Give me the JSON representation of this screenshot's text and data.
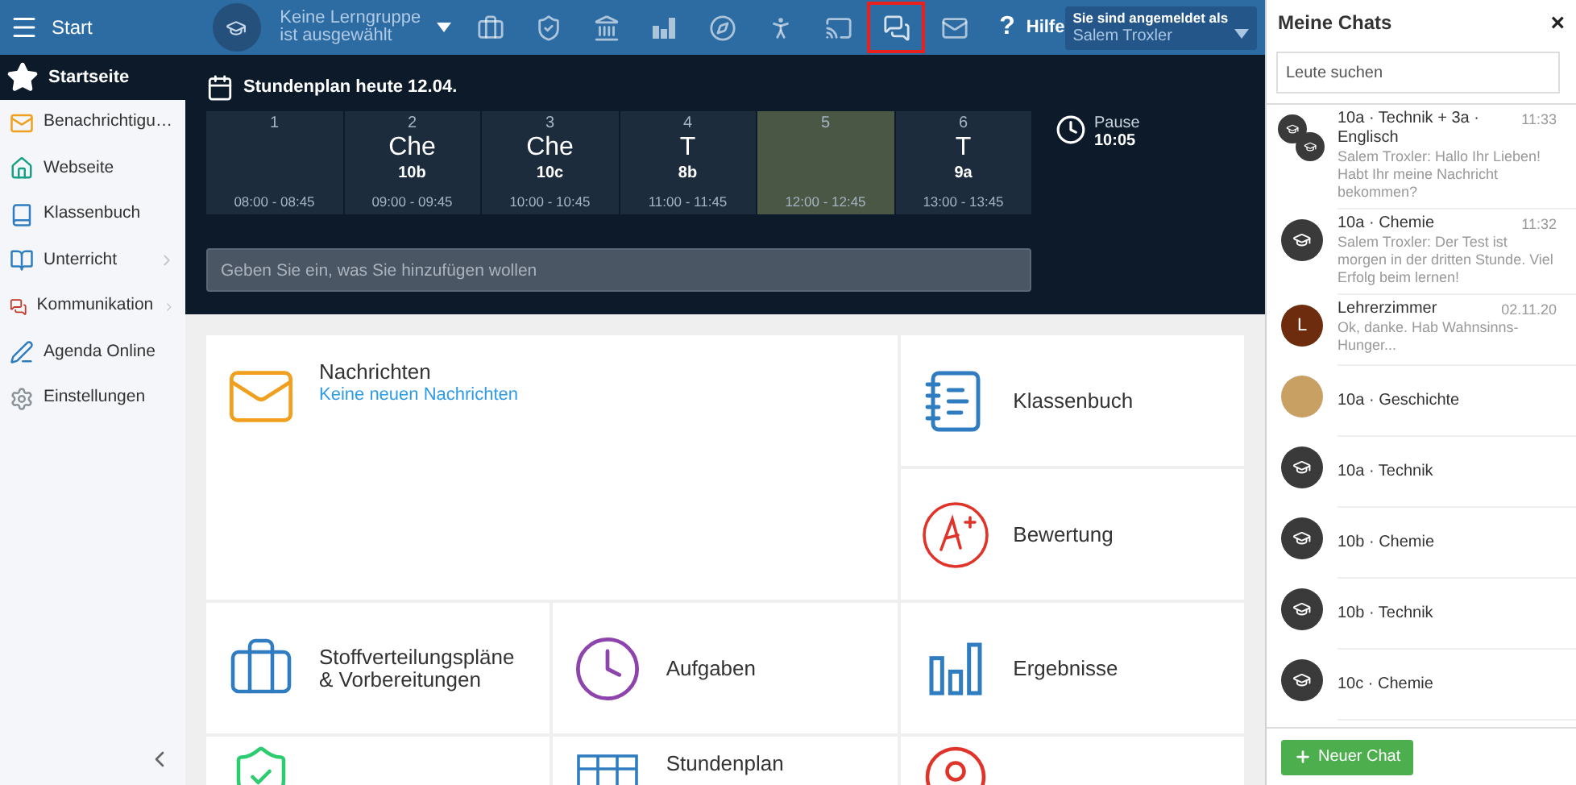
{
  "topbar": {
    "title": "Start",
    "group": {
      "line1": "Keine Lerngruppe",
      "line2": "ist ausgewählt"
    },
    "tools": [
      {
        "selected": false
      },
      {
        "selected": false
      },
      {
        "selected": false
      },
      {
        "selected": false
      },
      {
        "selected": false
      },
      {
        "selected": false
      },
      {
        "selected": false
      },
      {
        "selected": true
      },
      {
        "selected": false
      }
    ],
    "help": {
      "icon": "?",
      "label": "Hilfe"
    },
    "login": {
      "caption": "Sie sind angemeldet als",
      "user": "Salem Troxler"
    }
  },
  "sidebar": {
    "home": "Startseite",
    "items": [
      {
        "label": "Benachrichtigu…",
        "expandable": false
      },
      {
        "label": "Webseite",
        "expandable": false
      },
      {
        "label": "Klassenbuch",
        "expandable": false
      },
      {
        "label": "Unterricht",
        "expandable": true
      },
      {
        "label": "Kommunikation",
        "expandable": true
      },
      {
        "label": "Agenda Online",
        "expandable": false
      },
      {
        "label": "Einstellungen",
        "expandable": false
      }
    ]
  },
  "timetable": {
    "title": "Stundenplan heute 12.04.",
    "lessons": [
      {
        "period": "1",
        "time": "08:00 - 08:45",
        "current": false
      },
      {
        "period": "2",
        "subject": "Che",
        "class": "10b",
        "time": "09:00 - 09:45",
        "current": false
      },
      {
        "period": "3",
        "subject": "Che",
        "class": "10c",
        "time": "10:00 - 10:45",
        "current": false
      },
      {
        "period": "4",
        "subject": "T",
        "class": "8b",
        "time": "11:00 - 11:45",
        "current": false
      },
      {
        "period": "5",
        "time": "12:00 - 12:45",
        "current": true
      },
      {
        "period": "6",
        "subject": "T",
        "class": "9a",
        "time": "13:00 - 13:45",
        "current": false
      }
    ],
    "pause": {
      "label": "Pause",
      "time": "10:05"
    },
    "input": {
      "placeholder": "Geben Sie ein, was Sie hinzufügen wollen"
    }
  },
  "tiles": [
    {
      "kind": "tile",
      "label": "Nachrichten",
      "subtitle": "Keine neuen Nachrichten"
    },
    {
      "kind": "tile",
      "label": "Klassenbuch"
    },
    {
      "kind": "tile",
      "label": "Bewertung"
    },
    {
      "kind": "tile",
      "label": "Stoffverteilungspläne & Vorbereitungen"
    },
    {
      "kind": "tile",
      "label": "Aufgaben"
    },
    {
      "kind": "tile",
      "label": "Ergebnisse"
    },
    {
      "kind": "tile"
    },
    {
      "kind": "tile",
      "label": "Stundenplan"
    },
    {
      "kind": "tile"
    }
  ],
  "chats": {
    "title": "Meine Chats",
    "close": "×",
    "search": {
      "placeholder": "Leute suchen"
    },
    "items": [
      {
        "kind": "group",
        "title": "10a · Technik + 3a · Englisch",
        "time": "11:33",
        "preview": "Salem Troxler: Hallo Ihr Lieben! Habt Ihr meine Nachricht bekommen?"
      },
      {
        "kind": "class",
        "title": "10a · Chemie",
        "time": "11:32",
        "preview": "Salem Troxler: Der Test ist morgen in der dritten Stunde. Viel Erfolg beim lernen!"
      },
      {
        "kind": "letter",
        "initial": "L",
        "title": "Lehrerzimmer",
        "time": "02.11.20",
        "preview": "Ok, danke. Hab Wahnsinns-Hunger..."
      },
      {
        "kind": "photo",
        "title": "10a · Geschichte"
      },
      {
        "kind": "class",
        "title": "10a · Technik"
      },
      {
        "kind": "class",
        "title": "10b · Chemie"
      },
      {
        "kind": "class",
        "title": "10b · Technik"
      },
      {
        "kind": "class",
        "title": "10c · Chemie"
      }
    ],
    "new_chat": "Neuer Chat"
  }
}
